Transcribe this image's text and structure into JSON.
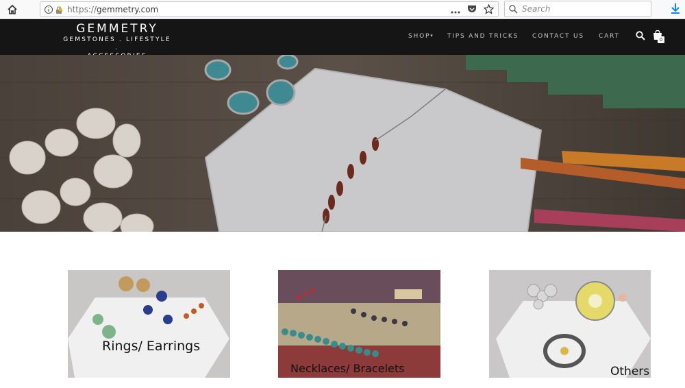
{
  "browser": {
    "url_scheme": "https://",
    "url_host": "gemmetry.com",
    "search_placeholder": "Search"
  },
  "site": {
    "brand": "GEMMETRY",
    "tagline_line1": "GEMSTONES . LIFESTYLE .",
    "tagline_line2": "ACCESSORIES",
    "menu": {
      "shop": "SHOP",
      "tips": "TIPS AND TRICKS",
      "contact": "CONTACT US",
      "cart": "CART"
    },
    "cart_count": "0"
  },
  "categories": [
    {
      "label": "Rings/ Earrings"
    },
    {
      "label": "Necklaces/ Bracelets"
    },
    {
      "label": "Others"
    }
  ],
  "colors": {
    "nav_background": "#151515",
    "chrome_background": "#f9f9fa",
    "accent_download": "#0a84ff"
  }
}
